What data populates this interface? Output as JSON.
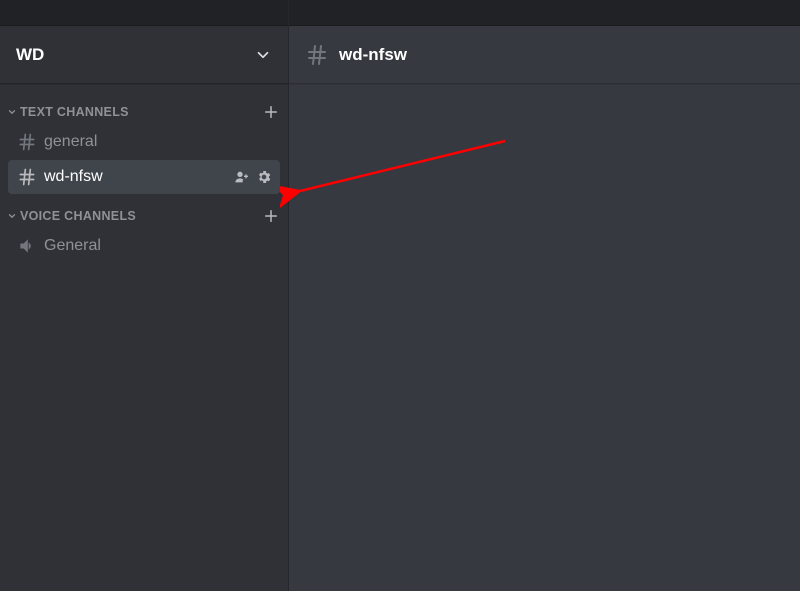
{
  "server": {
    "name": "WD"
  },
  "categories": [
    {
      "label": "TEXT CHANNELS",
      "type": "text",
      "channels": [
        {
          "name": "general",
          "selected": false
        },
        {
          "name": "wd-nfsw",
          "selected": true
        }
      ]
    },
    {
      "label": "VOICE CHANNELS",
      "type": "voice",
      "channels": [
        {
          "name": "General",
          "selected": false
        }
      ]
    }
  ],
  "current_channel": {
    "name": "wd-nfsw"
  },
  "annotation": {
    "color": "#ff0000"
  }
}
